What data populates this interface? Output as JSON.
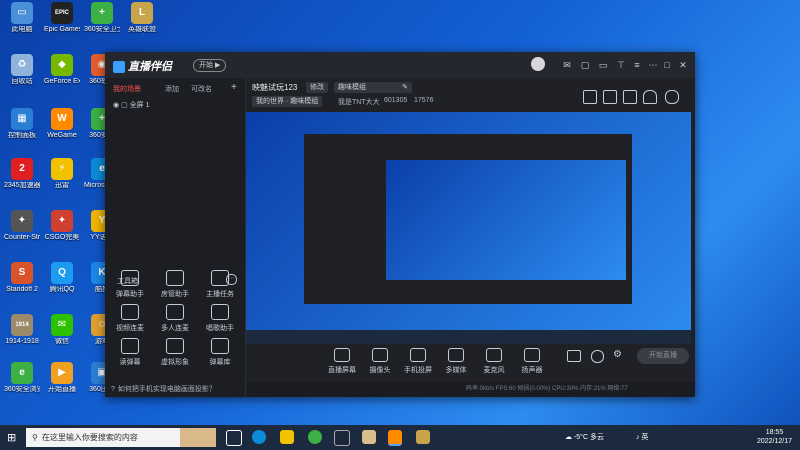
{
  "desktop": {
    "icons": [
      {
        "label": "此电脑",
        "color": "#4a90d9",
        "glyph": "▭"
      },
      {
        "label": "Epic Games Launcher",
        "color": "#222222",
        "glyph": "EPIC"
      },
      {
        "label": "360安全卫士",
        "color": "#3cb043",
        "glyph": "+"
      },
      {
        "label": "英雄联盟",
        "color": "#c8a44a",
        "glyph": "L"
      },
      {
        "label": "回收站",
        "color": "#8fb3d9",
        "glyph": "♻"
      },
      {
        "label": "GeForce Experience",
        "color": "#76b900",
        "glyph": "◆"
      },
      {
        "label": "360软件",
        "color": "#e85c2a",
        "glyph": "◉"
      },
      {
        "label": "控制面板",
        "color": "#2a7fd4",
        "glyph": "▦"
      },
      {
        "label": "WeGame",
        "color": "#ff8a00",
        "glyph": "W"
      },
      {
        "label": "360安全",
        "color": "#3cb043",
        "glyph": "+"
      },
      {
        "label": "2345加速器",
        "color": "#e02020",
        "glyph": "2"
      },
      {
        "label": "迅雷",
        "color": "#f2c200",
        "glyph": "⚡"
      },
      {
        "label": "Microsoft Edge",
        "color": "#0c8cd8",
        "glyph": "e"
      },
      {
        "label": "Counter-Strike",
        "color": "#555555",
        "glyph": "✦"
      },
      {
        "label": "CSGO完美",
        "color": "#d04030",
        "glyph": "✦"
      },
      {
        "label": "YY语音",
        "color": "#f0b400",
        "glyph": "Y"
      },
      {
        "label": "Standoff 2",
        "color": "#d9532b",
        "glyph": "S"
      },
      {
        "label": "腾讯QQ",
        "color": "#1d9bf0",
        "glyph": "Q"
      },
      {
        "label": "酷狗",
        "color": "#1a88e8",
        "glyph": "K"
      },
      {
        "label": "1914-1918",
        "color": "#9b8b6a",
        "glyph": "1914"
      },
      {
        "label": "微信",
        "color": "#2dc100",
        "glyph": "✉"
      },
      {
        "label": "游戏",
        "color": "#e0a030",
        "glyph": "☺"
      },
      {
        "label": "360压缩",
        "color": "#2a7fd4",
        "glyph": "▣"
      },
      {
        "label": "360安全浏览器",
        "color": "#3cb043",
        "glyph": "e"
      },
      {
        "label": "开始直播",
        "color": "#f0a020",
        "glyph": "▶"
      }
    ]
  },
  "app": {
    "logo_text": "直播伴侣",
    "badge": "开始 ▶",
    "left_tabs": [
      "我的场景",
      "添加",
      "可改名"
    ],
    "scene": {
      "name": "全屏 1"
    },
    "toolbox_title": "工具箱",
    "tools": [
      {
        "label": "弹幕助手"
      },
      {
        "label": "房管助手"
      },
      {
        "label": "主播任务"
      },
      {
        "label": "视频连麦"
      },
      {
        "label": "多人连麦"
      },
      {
        "label": "唱歌助手"
      },
      {
        "label": "读弹幕"
      },
      {
        "label": "虚拟形象"
      },
      {
        "label": "弹幕库"
      }
    ],
    "tip": "如何把手机实现电脑画面投影？",
    "room_title": "映魅试玩123",
    "room_edit": "修改",
    "category_placeholder": "趣味模组",
    "tags": [
      "我的世界 · 趣味模组",
      "我是TNT大大",
      "601305",
      "17576"
    ],
    "bottom_buttons": [
      "直播屏幕",
      "摄像头",
      "手机投屏",
      "多媒体",
      "麦克风",
      "扬声器"
    ],
    "start_button": "开始直播",
    "status_text": "码率:0kb/s    FPS:60    帧损(0.00%)    CPU:30%    内存:21%    网络:77"
  },
  "taskbar": {
    "search_placeholder": "在这里输入你要搜索的内容",
    "weather": "-5°C 多云",
    "ime": "英",
    "time": "18:55",
    "date": "2022/12/17"
  }
}
